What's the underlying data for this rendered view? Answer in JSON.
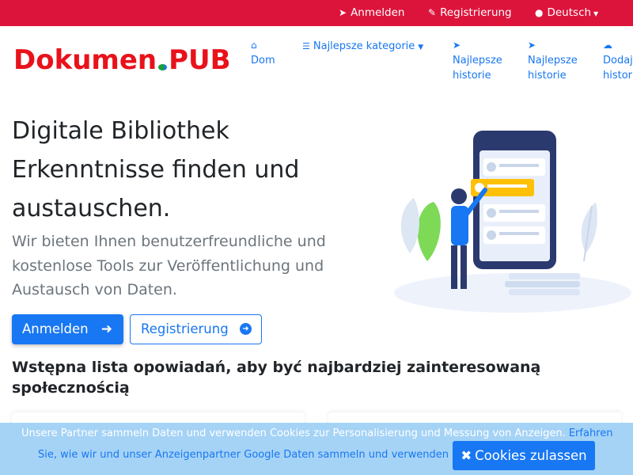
{
  "topbar": {
    "login_label": "Anmelden",
    "register_label": "Registrierung",
    "language_label": "Deutsch"
  },
  "logo": {
    "text_left": "Dokumen",
    "text_right": "PUB"
  },
  "nav": {
    "home_label": "Dom",
    "categories_label": "Najlepsze kategorie",
    "stories1_line1": "Najlepsze",
    "stories1_line2": "historie",
    "stories2_line1": "Najlepsze",
    "stories2_line2": "historie",
    "add_line1": "Dodaj",
    "add_line2": "historie"
  },
  "hero": {
    "title_line1": "Digitale Bibliothek",
    "title_line2": "Erkenntnisse finden und",
    "title_line3": "austauschen.",
    "subtitle": "Wir bieten Ihnen benutzerfreundliche und kostenlose Tools zur Veröffentlichung und Austausch von Daten.",
    "login_button": "Anmelden",
    "register_button": "Registrierung"
  },
  "section": {
    "title": "Wstępna lista opowiadań, aby być najbardziej zainteresowaną społecznością"
  },
  "cookie": {
    "message": "Unsere Partner sammeln Daten und verwenden Cookies zur Personalisierung und Messung von Anzeigen.",
    "link_part1": "Erfahren",
    "link_part2": "Sie, wie wir und unser Anzeigenpartner Google Daten sammeln und verwenden",
    "accept_button": "Cookies zulassen"
  },
  "colors": {
    "topbar": "#dc143c",
    "brand_red": "#e8121b",
    "primary": "#1877f2",
    "cookie_bg": "#87c4f3"
  },
  "icons": {
    "login": "sign-in-icon",
    "register": "edit-icon",
    "language": "globe-icon",
    "home": "home-icon",
    "categories": "list-icon",
    "stories": "paper-plane-icon",
    "add": "cloud-upload-icon",
    "arrow": "arrow-right-icon",
    "arrow_circle": "arrow-circle-right-icon",
    "close": "times-icon"
  }
}
